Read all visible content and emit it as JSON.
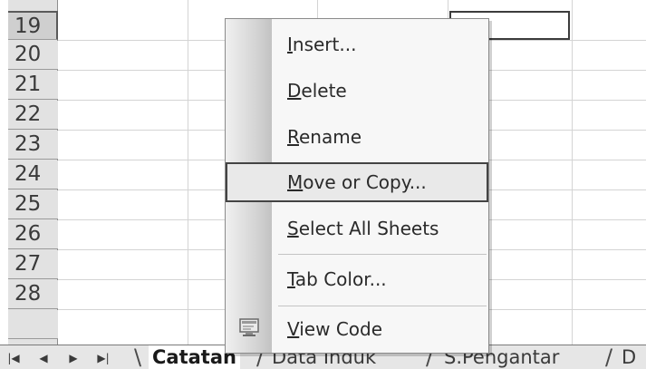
{
  "grid": {
    "rows": [
      "19",
      "20",
      "21",
      "22",
      "23",
      "24",
      "25",
      "26",
      "27",
      "28"
    ],
    "selected_row": "19"
  },
  "context_menu": {
    "items": [
      {
        "pre": "",
        "key": "I",
        "post": "nsert...",
        "icon": ""
      },
      {
        "pre": "",
        "key": "D",
        "post": "elete",
        "icon": ""
      },
      {
        "pre": "",
        "key": "R",
        "post": "ename",
        "icon": ""
      },
      {
        "pre": "",
        "key": "M",
        "post": "ove or Copy...",
        "icon": "",
        "highlighted": true
      },
      {
        "pre": "",
        "key": "S",
        "post": "elect All Sheets",
        "icon": ""
      },
      {
        "pre": "",
        "key": "T",
        "post": "ab Color...",
        "icon": ""
      },
      {
        "pre": "",
        "key": "V",
        "post": "iew Code",
        "icon": "view-code-icon"
      }
    ]
  },
  "tabbar": {
    "nav": [
      "first-sheet",
      "previous-sheet",
      "next-sheet",
      "last-sheet"
    ],
    "tabs": [
      "Catatan",
      "Data Induk",
      "S.Pengantar",
      "D"
    ],
    "active_tab": "Catatan"
  }
}
